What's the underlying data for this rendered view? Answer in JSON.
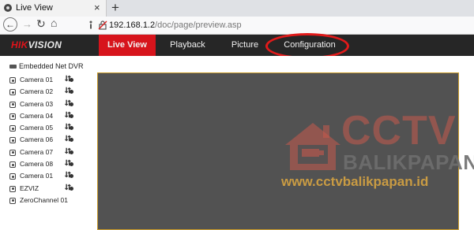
{
  "browser": {
    "tab_title": "Live View",
    "tab_close": "×",
    "new_tab": "+",
    "nav": {
      "back": "←",
      "forward": "→",
      "reload": "↻",
      "home": "⌂"
    },
    "url_host": "192.168.1.2",
    "url_path": "/doc/page/preview.asp"
  },
  "app": {
    "logo_red": "HIK",
    "logo_white": "VISION",
    "nav": {
      "live_view": "Live View",
      "playback": "Playback",
      "picture": "Picture",
      "configuration": "Configuration"
    },
    "accent_color": "#d7141c",
    "highlight_color": "#e21a1a"
  },
  "sidebar": {
    "device": "Embedded Net DVR",
    "channels": [
      {
        "label": "Camera 01",
        "control": "⮃"
      },
      {
        "label": "Camera 02",
        "control": "⮃"
      },
      {
        "label": "Camera 03",
        "control": "⮃"
      },
      {
        "label": "Camera 04",
        "control": "⮃"
      },
      {
        "label": "Camera 05",
        "control": "⮃"
      },
      {
        "label": "Camera 06",
        "control": "⮃"
      },
      {
        "label": "Camera 07",
        "control": "⮃"
      },
      {
        "label": "Camera 08",
        "control": "⮃"
      },
      {
        "label": "Camera 01",
        "control": "⮃"
      },
      {
        "label": "EZVIZ",
        "control": "⮃"
      },
      {
        "label": "ZeroChannel 01",
        "control": ""
      }
    ]
  },
  "watermark": {
    "brand": "CCTV",
    "city": "BALIKPAPAN",
    "url": "www.cctvbalikpapan.id"
  }
}
